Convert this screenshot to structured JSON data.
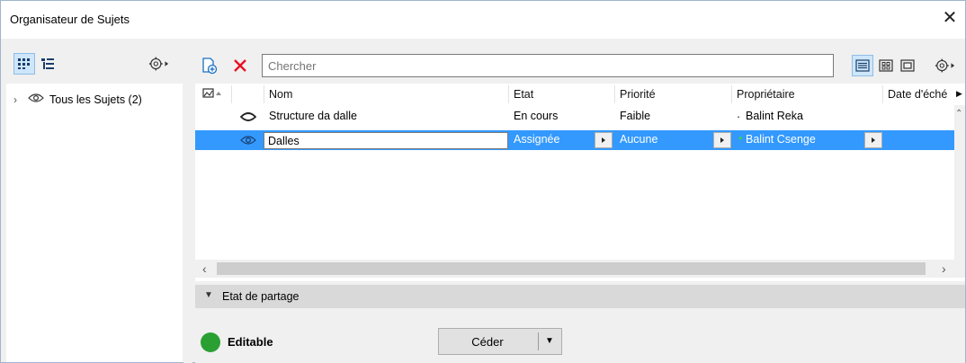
{
  "window": {
    "title": "Organisateur de Sujets",
    "close_glyph": "✕"
  },
  "left_panel": {
    "tree": [
      {
        "label": "Tous les Sujets (2)",
        "expand_glyph": "›"
      }
    ]
  },
  "toolbar": {
    "search_placeholder": "Chercher",
    "search_value": ""
  },
  "grid": {
    "columns": [
      "Nom",
      "Etat",
      "Priorité",
      "Propriétaire",
      "Date d'éché"
    ],
    "rows": [
      {
        "name": "Structure da dalle",
        "state": "En cours",
        "priority": "Faible",
        "owner": "Balint Reka",
        "owner_dot": "·",
        "selected": false
      },
      {
        "name": "Dalles",
        "state": "Assignée",
        "priority": "Aucune",
        "owner": "Balint Csenge",
        "owner_dot": "•",
        "selected": true
      }
    ],
    "scroll_left_glyph": "‹",
    "scroll_right_glyph": "›"
  },
  "sharing": {
    "section_title": "Etat de partage",
    "section_toggle": "▼",
    "status_label": "Editable",
    "status_color": "#2aa033",
    "action_button": "Céder",
    "action_arrow": "▼"
  },
  "colors": {
    "selection": "#3399ff",
    "delete": "#e81123",
    "accent": "#1a6fc4"
  }
}
